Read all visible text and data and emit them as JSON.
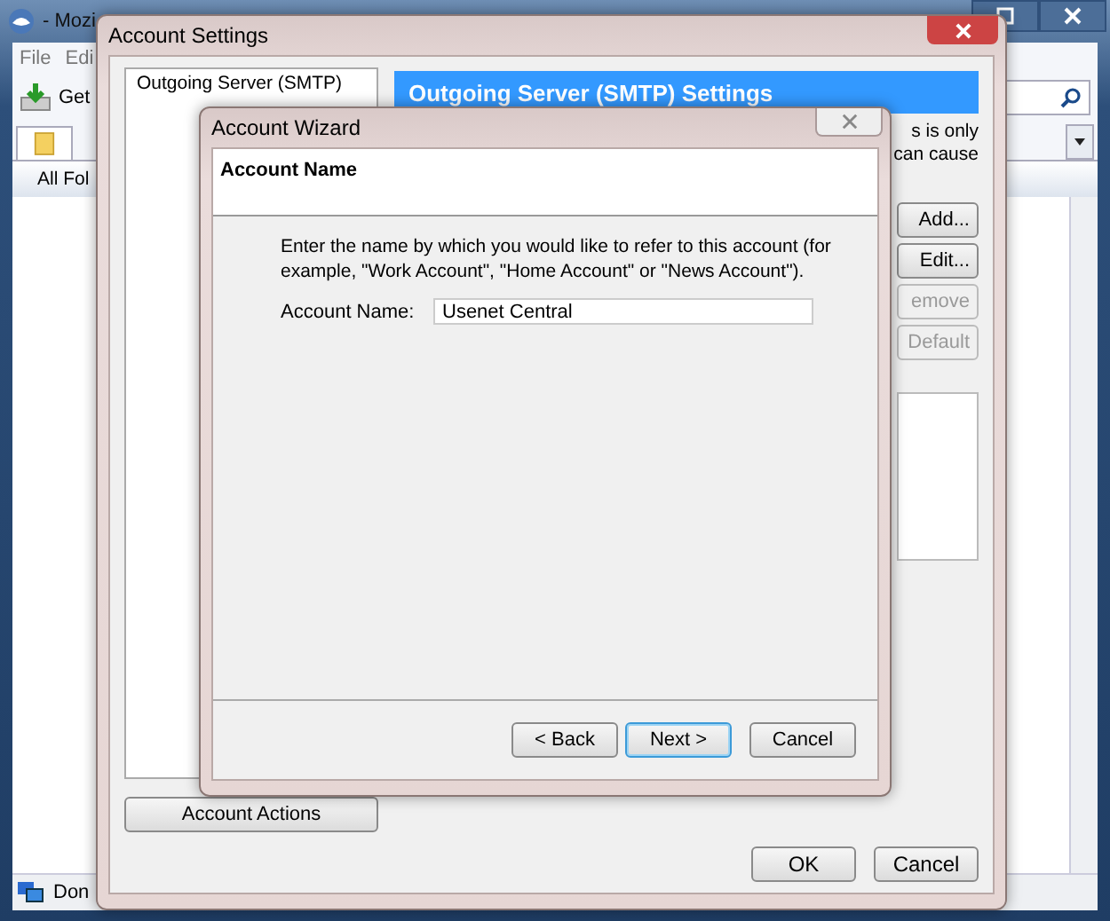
{
  "main_window": {
    "title": "- Mozi",
    "menu": [
      "File",
      "Edi"
    ],
    "get_mail": "Get",
    "folder_header": "All Fol",
    "status": "Don"
  },
  "account_settings": {
    "title": "Account Settings",
    "sidebar_items": [
      "Outgoing Server (SMTP)"
    ],
    "heading": "Outgoing Server (SMTP) Settings",
    "description_lines": [
      "s is only",
      "can cause"
    ],
    "buttons": [
      {
        "label": "Add...",
        "disabled": false
      },
      {
        "label": "Edit...",
        "disabled": false
      },
      {
        "label": "emove",
        "disabled": true
      },
      {
        "label": "Default",
        "disabled": true
      }
    ],
    "account_actions": "Account Actions",
    "footer_buttons": [
      "OK",
      "Cancel"
    ]
  },
  "wizard": {
    "title": "Account Wizard",
    "heading": "Account Name",
    "description": "Enter the name by which you would like to refer to this account (for example, \"Work Account\", \"Home Account\" or \"News Account\").",
    "field": {
      "label": "Account Name:",
      "value": "Usenet Central"
    },
    "buttons": [
      {
        "label": "< Back",
        "default": false
      },
      {
        "label": "Next >",
        "default": true
      },
      {
        "label": "Cancel",
        "default": false
      }
    ]
  }
}
